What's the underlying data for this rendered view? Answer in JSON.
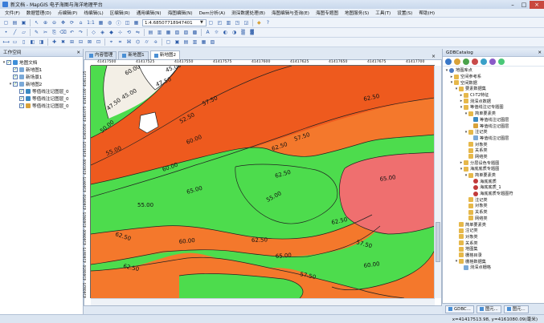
{
  "window": {
    "title": "新文档 - MapGIS 电子海图与海洋地理平台",
    "controls": [
      "–",
      "□",
      "×"
    ]
  },
  "menu": [
    "文件(F)",
    "数据管理(D)",
    "点编辑(P)",
    "线编辑(L)",
    "区编辑(R)",
    "通用编辑(N)",
    "海图编辑(N)",
    "Dem分析(A)",
    "测深数据处理(B)",
    "海图编辑与查询(E)",
    "海图专题图",
    "地图服务(S)",
    "工具(T)",
    "设置(S)",
    "帮助(H)"
  ],
  "toolbar": {
    "scale_value": "1:4.68507718947401",
    "ratio_text": "1:1"
  },
  "left_panel": {
    "title": "工作空间",
    "pin": "✕",
    "tree": [
      {
        "label": "地图文档",
        "level": 0,
        "expander": "▾",
        "checked": true,
        "icon": "map"
      },
      {
        "label": "新地图1",
        "level": 1,
        "expander": "",
        "checked": true,
        "icon": "layer"
      },
      {
        "label": "新场景1",
        "level": 1,
        "expander": "",
        "checked": true,
        "icon": "layer"
      },
      {
        "label": "新地图2",
        "level": 1,
        "expander": "▾",
        "checked": true,
        "icon": "layer"
      },
      {
        "label": "等值线注记图层_0",
        "level": 2,
        "expander": "",
        "checked": true,
        "icon": "line"
      },
      {
        "label": "等值线注记图层_0",
        "level": 2,
        "expander": "",
        "checked": true,
        "icon": "line"
      },
      {
        "label": "等值线注记图层_0",
        "level": 2,
        "expander": "",
        "checked": true,
        "icon": "poly"
      }
    ]
  },
  "doc_tabs": [
    {
      "label": "内容管理",
      "active": false
    },
    {
      "label": "新地图1",
      "active": false
    },
    {
      "label": "新地图2",
      "active": true
    }
  ],
  "doc_close": "×",
  "ruler": {
    "x_labels": [
      "41417500",
      "41417525",
      "41417550",
      "41417575",
      "41417600",
      "41417625",
      "41417650",
      "41417675",
      "41417700"
    ],
    "y_labels": [
      "4161125",
      "4161100",
      "4161075",
      "4161050",
      "4161025",
      "4161000",
      "4160975",
      "4160950",
      "4160925",
      "4160900",
      "4160875",
      "4160850",
      "4160825"
    ]
  },
  "map": {
    "colors": {
      "green": "#4ddc4d",
      "orange": "#f4782c",
      "orange_dark": "#ee5a1e",
      "pink": "#ef6f6f",
      "white": "#ffffff",
      "pale": "#f3efe6",
      "line": "#222222"
    },
    "contour_labels": [
      {
        "text": "60.00"
      },
      {
        "text": "47.50"
      },
      {
        "text": "45.00"
      },
      {
        "text": "45.00"
      },
      {
        "text": "47.50"
      },
      {
        "text": "50.00"
      },
      {
        "text": "52.50"
      },
      {
        "text": "55.00"
      },
      {
        "text": "57.50"
      },
      {
        "text": "60.00"
      },
      {
        "text": "62.50"
      },
      {
        "text": "62.50"
      },
      {
        "text": "65.00"
      },
      {
        "text": "62.50"
      },
      {
        "text": "60.00"
      },
      {
        "text": "57.50"
      },
      {
        "text": "55.00"
      },
      {
        "text": "55.00"
      },
      {
        "text": "65.00"
      },
      {
        "text": "62.50"
      },
      {
        "text": "60.00"
      },
      {
        "text": "62.50"
      },
      {
        "text": "65.00"
      },
      {
        "text": "60.00"
      },
      {
        "text": "57.50"
      },
      {
        "text": "62.50"
      },
      {
        "text": "57.50"
      },
      {
        "text": "62.50"
      }
    ]
  },
  "right_panel": {
    "title": "GDBCatalog",
    "pin": "✕",
    "tool_colors": [
      "#3a78c8",
      "#d8a23a",
      "#4aa24a",
      "#c84a4a",
      "#3aa0c8",
      "#8a5ac8",
      "#4ac878"
    ],
    "tree": [
      {
        "label": "地图库点",
        "level": 0,
        "expander": "▾",
        "icon": "db"
      },
      {
        "label": "空间参考系",
        "level": 1,
        "expander": "▸",
        "icon": "folder"
      },
      {
        "label": "空间数据",
        "level": 1,
        "expander": "▾",
        "icon": "folder"
      },
      {
        "label": "要素数据集",
        "level": 2,
        "expander": "▾",
        "icon": "folder"
      },
      {
        "label": "CI-T2特征",
        "level": 3,
        "expander": "▸",
        "icon": "folder"
      },
      {
        "label": "测深点数据",
        "level": 3,
        "expander": "▸",
        "icon": "folder"
      },
      {
        "label": "等值线注记专题图",
        "level": 3,
        "expander": "▾",
        "icon": "folder"
      },
      {
        "label": "简单要素类",
        "level": 4,
        "expander": "▾",
        "icon": "folder"
      },
      {
        "label": "等值线注记图层",
        "level": 5,
        "expander": "",
        "icon": "line"
      },
      {
        "label": "等值线注记图层",
        "level": 5,
        "expander": "",
        "icon": "poly"
      },
      {
        "label": "注记类",
        "level": 4,
        "expander": "▾",
        "icon": "folder"
      },
      {
        "label": "等值线注记图层",
        "level": 5,
        "expander": "",
        "icon": "layer"
      },
      {
        "label": "对象类",
        "level": 4,
        "expander": "",
        "icon": "folder"
      },
      {
        "label": "关系类",
        "level": 4,
        "expander": "",
        "icon": "folder"
      },
      {
        "label": "网络类",
        "level": 4,
        "expander": "",
        "icon": "folder"
      },
      {
        "label": "分层设色专题图",
        "level": 3,
        "expander": "▸",
        "icon": "folder"
      },
      {
        "label": "海底底质专题图",
        "level": 3,
        "expander": "▾",
        "icon": "folder"
      },
      {
        "label": "简单要素类",
        "level": 4,
        "expander": "▾",
        "icon": "folder"
      },
      {
        "label": "海底底质",
        "level": 5,
        "expander": "",
        "icon": "point"
      },
      {
        "label": "海底底质_1",
        "level": 5,
        "expander": "",
        "icon": "point"
      },
      {
        "label": "海底底质专题图符",
        "level": 5,
        "expander": "",
        "icon": "point"
      },
      {
        "label": "注记类",
        "level": 4,
        "expander": "",
        "icon": "folder"
      },
      {
        "label": "对象类",
        "level": 4,
        "expander": "",
        "icon": "folder"
      },
      {
        "label": "关系类",
        "level": 4,
        "expander": "",
        "icon": "folder"
      },
      {
        "label": "网络类",
        "level": 4,
        "expander": "",
        "icon": "folder"
      },
      {
        "label": "简单要素类",
        "level": 2,
        "expander": "",
        "icon": "folder"
      },
      {
        "label": "注记类",
        "level": 2,
        "expander": "",
        "icon": "folder"
      },
      {
        "label": "对象类",
        "level": 2,
        "expander": "",
        "icon": "folder"
      },
      {
        "label": "关系类",
        "level": 2,
        "expander": "",
        "icon": "folder"
      },
      {
        "label": "地图集",
        "level": 2,
        "expander": "",
        "icon": "folder"
      },
      {
        "label": "栅格目录",
        "level": 2,
        "expander": "",
        "icon": "folder"
      },
      {
        "label": "栅格数据集",
        "level": 2,
        "expander": "▾",
        "icon": "folder"
      },
      {
        "label": "测深点栅格",
        "level": 3,
        "expander": "",
        "icon": "layer"
      }
    ],
    "bottom_tabs": [
      "GDBC...",
      "图元...",
      "图元..."
    ]
  },
  "status": {
    "coords": "x=41417513.98, y=4161080.09(毫米)"
  }
}
